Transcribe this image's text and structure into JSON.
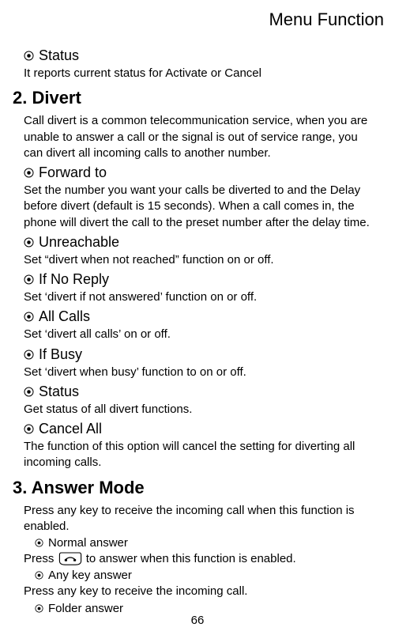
{
  "header": "Menu Function",
  "status1": {
    "title": "Status",
    "desc": "It reports current status for Activate or Cancel"
  },
  "sec_divert": {
    "heading": "2. Divert",
    "intro": "Call divert is a common telecommunication service, when you are unable to answer a call or the signal is out of service range, you can divert all incoming calls to another number.",
    "items": [
      {
        "title": "Forward to",
        "desc": "Set the number you want your calls be diverted to and the Delay before divert (default is 15 seconds). When a call comes in, the phone will divert the call to the preset number after the delay time."
      },
      {
        "title": "Unreachable",
        "desc": "Set “divert when not reached” function on or off."
      },
      {
        "title": "If No Reply",
        "desc": "Set ‘divert if not answered’ function on or off."
      },
      {
        "title": "All Calls",
        "desc": "Set ‘divert all calls’ on or off."
      },
      {
        "title": "If Busy",
        "desc": "Set ‘divert when busy’ function to on or off."
      },
      {
        "title": "Status",
        "desc": "Get status of all divert functions."
      },
      {
        "title": "Cancel All",
        "desc": "The function of this option will cancel the setting for diverting all incoming calls."
      }
    ]
  },
  "sec_answer": {
    "heading": "3. Answer Mode",
    "intro": "Press any key to receive the incoming call when this function is enabled.",
    "items": [
      {
        "label": "Normal answer"
      },
      {
        "label": "Any key answer"
      },
      {
        "label": "Folder answer"
      }
    ],
    "press_prefix": "Press",
    "press_suffix": " to answer when this function is enabled.",
    "anykey_desc": "Press any key to receive the incoming call."
  },
  "page_number": "66"
}
